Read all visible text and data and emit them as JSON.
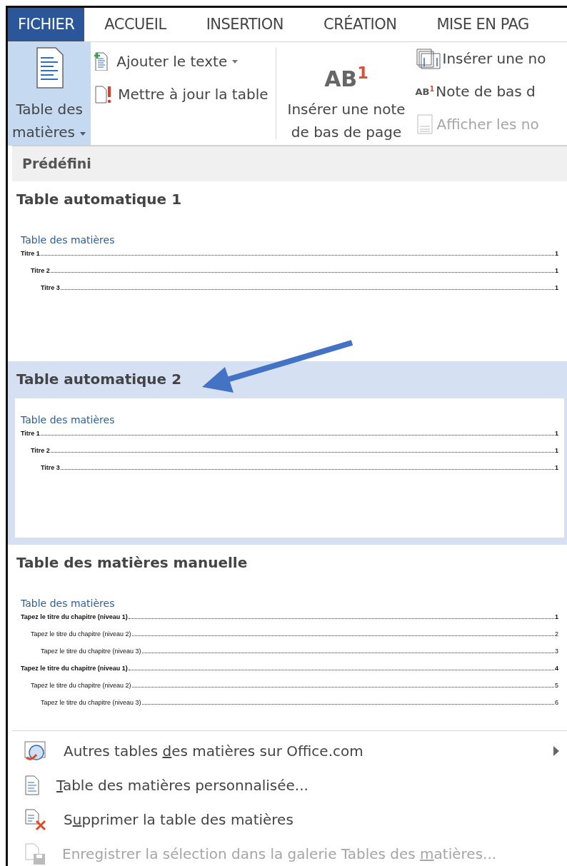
{
  "tabs": [
    {
      "label": "FICHIER",
      "selected": true
    },
    {
      "label": "ACCUEIL",
      "selected": false
    },
    {
      "label": "INSERTION",
      "selected": false
    },
    {
      "label": "CRÉATION",
      "selected": false
    },
    {
      "label": "MISE EN PAG",
      "selected": false
    }
  ],
  "ribbon": {
    "toc_button": {
      "label_line1": "Table des",
      "label_line2": "matières",
      "active": true
    },
    "small_buttons": [
      {
        "kind": "add-text",
        "label": "Ajouter le texte",
        "dropdown": true,
        "disabled": false
      },
      {
        "kind": "update",
        "label": "Mettre à jour la table",
        "dropdown": false,
        "disabled": false
      }
    ],
    "footnote_button": {
      "icon_text": "AB",
      "icon_sup": "1",
      "label_line1": "Insérer une note",
      "label_line2": "de bas de page"
    },
    "right_buttons": [
      {
        "kind": "endnote",
        "label": "Insérer une no",
        "disabled": false
      },
      {
        "kind": "next",
        "icon_text": "AB",
        "icon_sup": "1",
        "label": "Note de bas d",
        "disabled": false
      },
      {
        "kind": "show",
        "label": "Afficher les no",
        "disabled": true
      }
    ]
  },
  "gallery": {
    "header": "Prédéfini",
    "items": [
      {
        "title": "Table automatique 1",
        "selected": false,
        "preview": {
          "heading": "Table des matières",
          "entries": [
            {
              "text": "Titre 1",
              "page": "1",
              "bold": true,
              "children": [
                {
                  "text": "Titre 2",
                  "page": "1",
                  "bold": true,
                  "children": [
                    {
                      "text": "Titre 3",
                      "page": "1",
                      "bold": true
                    }
                  ]
                }
              ]
            }
          ]
        }
      },
      {
        "title": "Table automatique 2",
        "selected": true,
        "preview": {
          "heading": "Table des matières",
          "entries": [
            {
              "text": "Titre 1",
              "page": "1",
              "bold": true,
              "children": [
                {
                  "text": "Titre 2",
                  "page": "1",
                  "bold": true,
                  "children": [
                    {
                      "text": "Titre 3",
                      "page": "1",
                      "bold": true
                    }
                  ]
                }
              ]
            }
          ]
        }
      },
      {
        "title": "Table des matières manuelle",
        "selected": false,
        "preview": {
          "heading": "Table des matières",
          "entries": [
            {
              "text": "Tapez le titre du chapitre (niveau 1)",
              "page": "1",
              "bold": true,
              "children": [
                {
                  "text": "Tapez le titre du chapitre (niveau 2)",
                  "page": "2",
                  "bold": false,
                  "children": [
                    {
                      "text": "Tapez le titre du chapitre (niveau 3)",
                      "page": "3",
                      "bold": false
                    }
                  ]
                }
              ]
            },
            {
              "text": "Tapez le titre du chapitre (niveau 1)",
              "page": "4",
              "bold": true,
              "children": [
                {
                  "text": "Tapez le titre du chapitre (niveau 2)",
                  "page": "5",
                  "bold": false,
                  "children": [
                    {
                      "text": "Tapez le titre du chapitre (niveau 3)",
                      "page": "6",
                      "bold": false
                    }
                  ]
                }
              ]
            }
          ]
        }
      }
    ]
  },
  "menu": [
    {
      "kind": "online",
      "pre": "Autres tables ",
      "key": "d",
      "post": "es matières sur Office.com",
      "submenu": true,
      "disabled": false
    },
    {
      "kind": "custom",
      "key": "T",
      "post": "able des matières personnalisée...",
      "submenu": false,
      "disabled": false
    },
    {
      "kind": "remove",
      "pre": "S",
      "key": "u",
      "post": "pprimer la table des matières",
      "submenu": false,
      "disabled": false
    },
    {
      "kind": "save",
      "pre": "Enregistrer la sélection dans la galerie Tables des ",
      "key": "m",
      "post": "atières...",
      "submenu": false,
      "disabled": true
    }
  ]
}
